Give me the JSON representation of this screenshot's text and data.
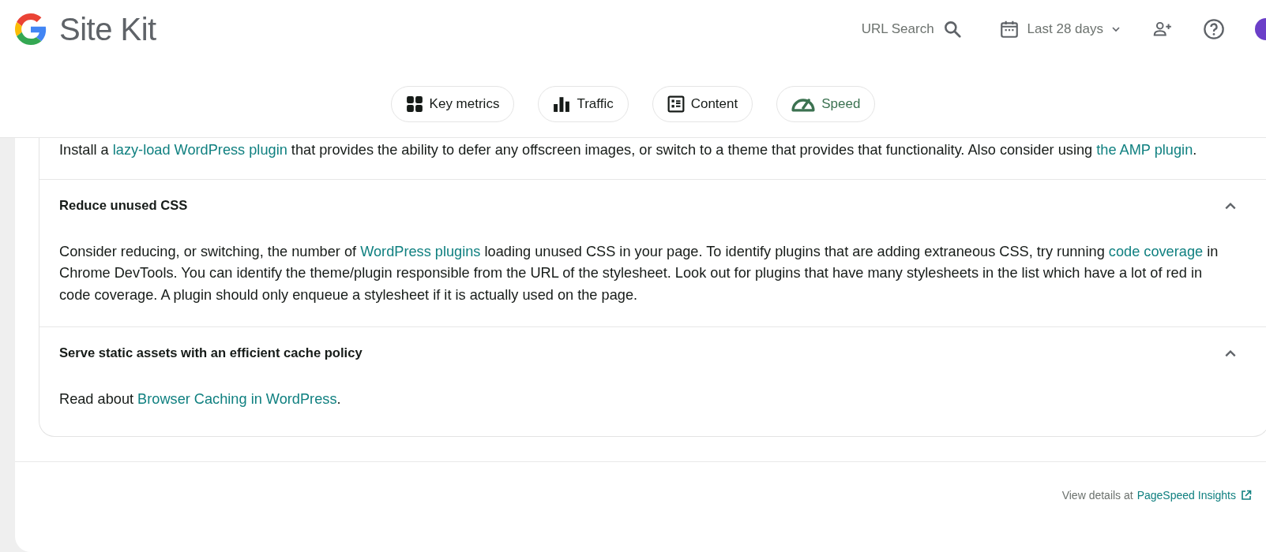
{
  "header": {
    "brand": "Site Kit",
    "url_search": "URL Search",
    "date_range": "Last 28 days"
  },
  "tabs": [
    {
      "label": "Key metrics",
      "kind": "grid",
      "selected": false
    },
    {
      "label": "Traffic",
      "kind": "bars",
      "selected": false
    },
    {
      "label": "Content",
      "kind": "list",
      "selected": false
    },
    {
      "label": "Speed",
      "kind": "gauge",
      "selected": true
    }
  ],
  "intro_paragraph": [
    {
      "kind": "text",
      "text": "Install a "
    },
    {
      "kind": "link",
      "text": "lazy-load WordPress plugin"
    },
    {
      "kind": "text",
      "text": " that provides the ability to defer any offscreen images, or switch to a theme that provides that functionality. Also consider using "
    },
    {
      "kind": "link",
      "text": "the AMP plugin"
    },
    {
      "kind": "text",
      "text": "."
    }
  ],
  "sections": [
    {
      "title": "Reduce unused CSS",
      "expanded": true,
      "body": [
        {
          "kind": "text",
          "text": "Consider reducing, or switching, the number of "
        },
        {
          "kind": "link",
          "text": "WordPress plugins"
        },
        {
          "kind": "text",
          "text": " loading unused CSS in your page. To identify plugins that are adding extraneous CSS, try running "
        },
        {
          "kind": "link",
          "text": "code coverage"
        },
        {
          "kind": "text",
          "text": " in Chrome DevTools. You can identify the theme/plugin responsible from the URL of the stylesheet. Look out for plugins that have many stylesheets in the list which have a lot of red in code coverage. A plugin should only enqueue a stylesheet if it is actually used on the page."
        }
      ]
    },
    {
      "title": "Serve static assets with an efficient cache policy",
      "expanded": true,
      "body": [
        {
          "kind": "text",
          "text": "Read about "
        },
        {
          "kind": "link",
          "text": "Browser Caching in WordPress"
        },
        {
          "kind": "text",
          "text": "."
        }
      ]
    }
  ],
  "footer": {
    "prefix": "View details at",
    "link": "PageSpeed Insights"
  }
}
